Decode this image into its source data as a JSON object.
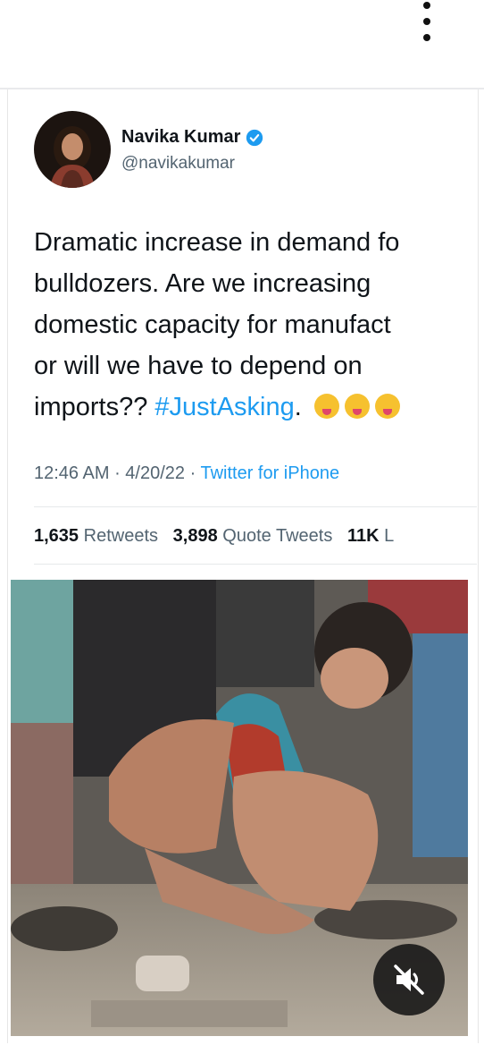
{
  "tweet": {
    "author_name": "Navika Kumar",
    "author_handle": "@navikakumar",
    "text_lines": [
      "Dramatic increase in demand fo",
      "bulldozers. Are we increasing",
      "domestic capacity for manufact",
      "or will we have to depend on"
    ],
    "last_line_prefix": "imports?? ",
    "hashtag": "#JustAsking",
    "last_line_suffix": ".",
    "emoji_icons": [
      "squinting-tongue-emoji",
      "squinting-tongue-emoji",
      "laughing-tears-emoji"
    ],
    "time": "12:46 AM",
    "date": "4/20/22",
    "separator": " · ",
    "source": "Twitter for iPhone",
    "stats": {
      "retweets_count": "1,635",
      "retweets_label": "Retweets",
      "quotes_count": "3,898",
      "quotes_label": "Quote Tweets",
      "likes_count": "11K",
      "likes_label": "L"
    }
  },
  "media": {
    "type": "video",
    "mute_icon": "muted-speaker-icon"
  },
  "colors": {
    "link": "#1d9bf0",
    "verified": "#1d9bf0",
    "secondary_text": "#536471"
  }
}
